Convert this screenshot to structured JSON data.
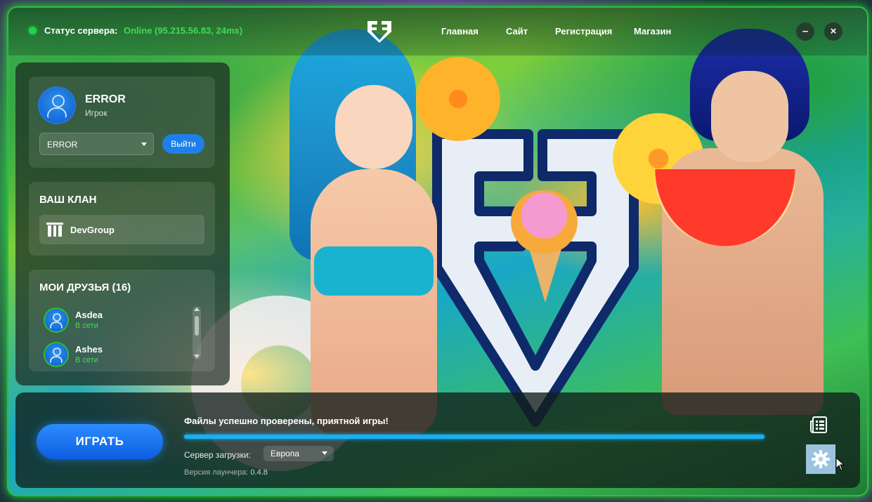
{
  "header": {
    "status_label": "Статус сервера:",
    "status_value": "Online (95.215.56.83, 24ms)",
    "nav": [
      "Главная",
      "Сайт",
      "Регистрация",
      "Магазин"
    ],
    "minimize": "–",
    "close": "×"
  },
  "profile": {
    "name": "ERROR",
    "role": "Игрок",
    "account_selected": "ERROR",
    "logout_label": "Выйти"
  },
  "clan": {
    "title": "ВАШ КЛАН",
    "name": "DevGroup"
  },
  "friends": {
    "title": "МОИ ДРУЗЬЯ (16)",
    "items": [
      {
        "name": "Asdea",
        "status": "В сети"
      },
      {
        "name": "Ashes",
        "status": "В сети"
      }
    ]
  },
  "bottom": {
    "play_label": "ИГРАТЬ",
    "message": "Файлы успешно проверены, приятной игры!",
    "progress": 1.0,
    "download_label": "Сервер загрузки:",
    "download_server": "Европа",
    "version_label": "Версия лаунчера:",
    "version_value": "0.4.8"
  },
  "colors": {
    "accent": "#1f7fe8",
    "online": "#3ddc57",
    "border_glow": "#27c238",
    "progress": "#18b0f5"
  },
  "icons": {
    "news": "news-list-icon",
    "settings": "gear-icon"
  }
}
